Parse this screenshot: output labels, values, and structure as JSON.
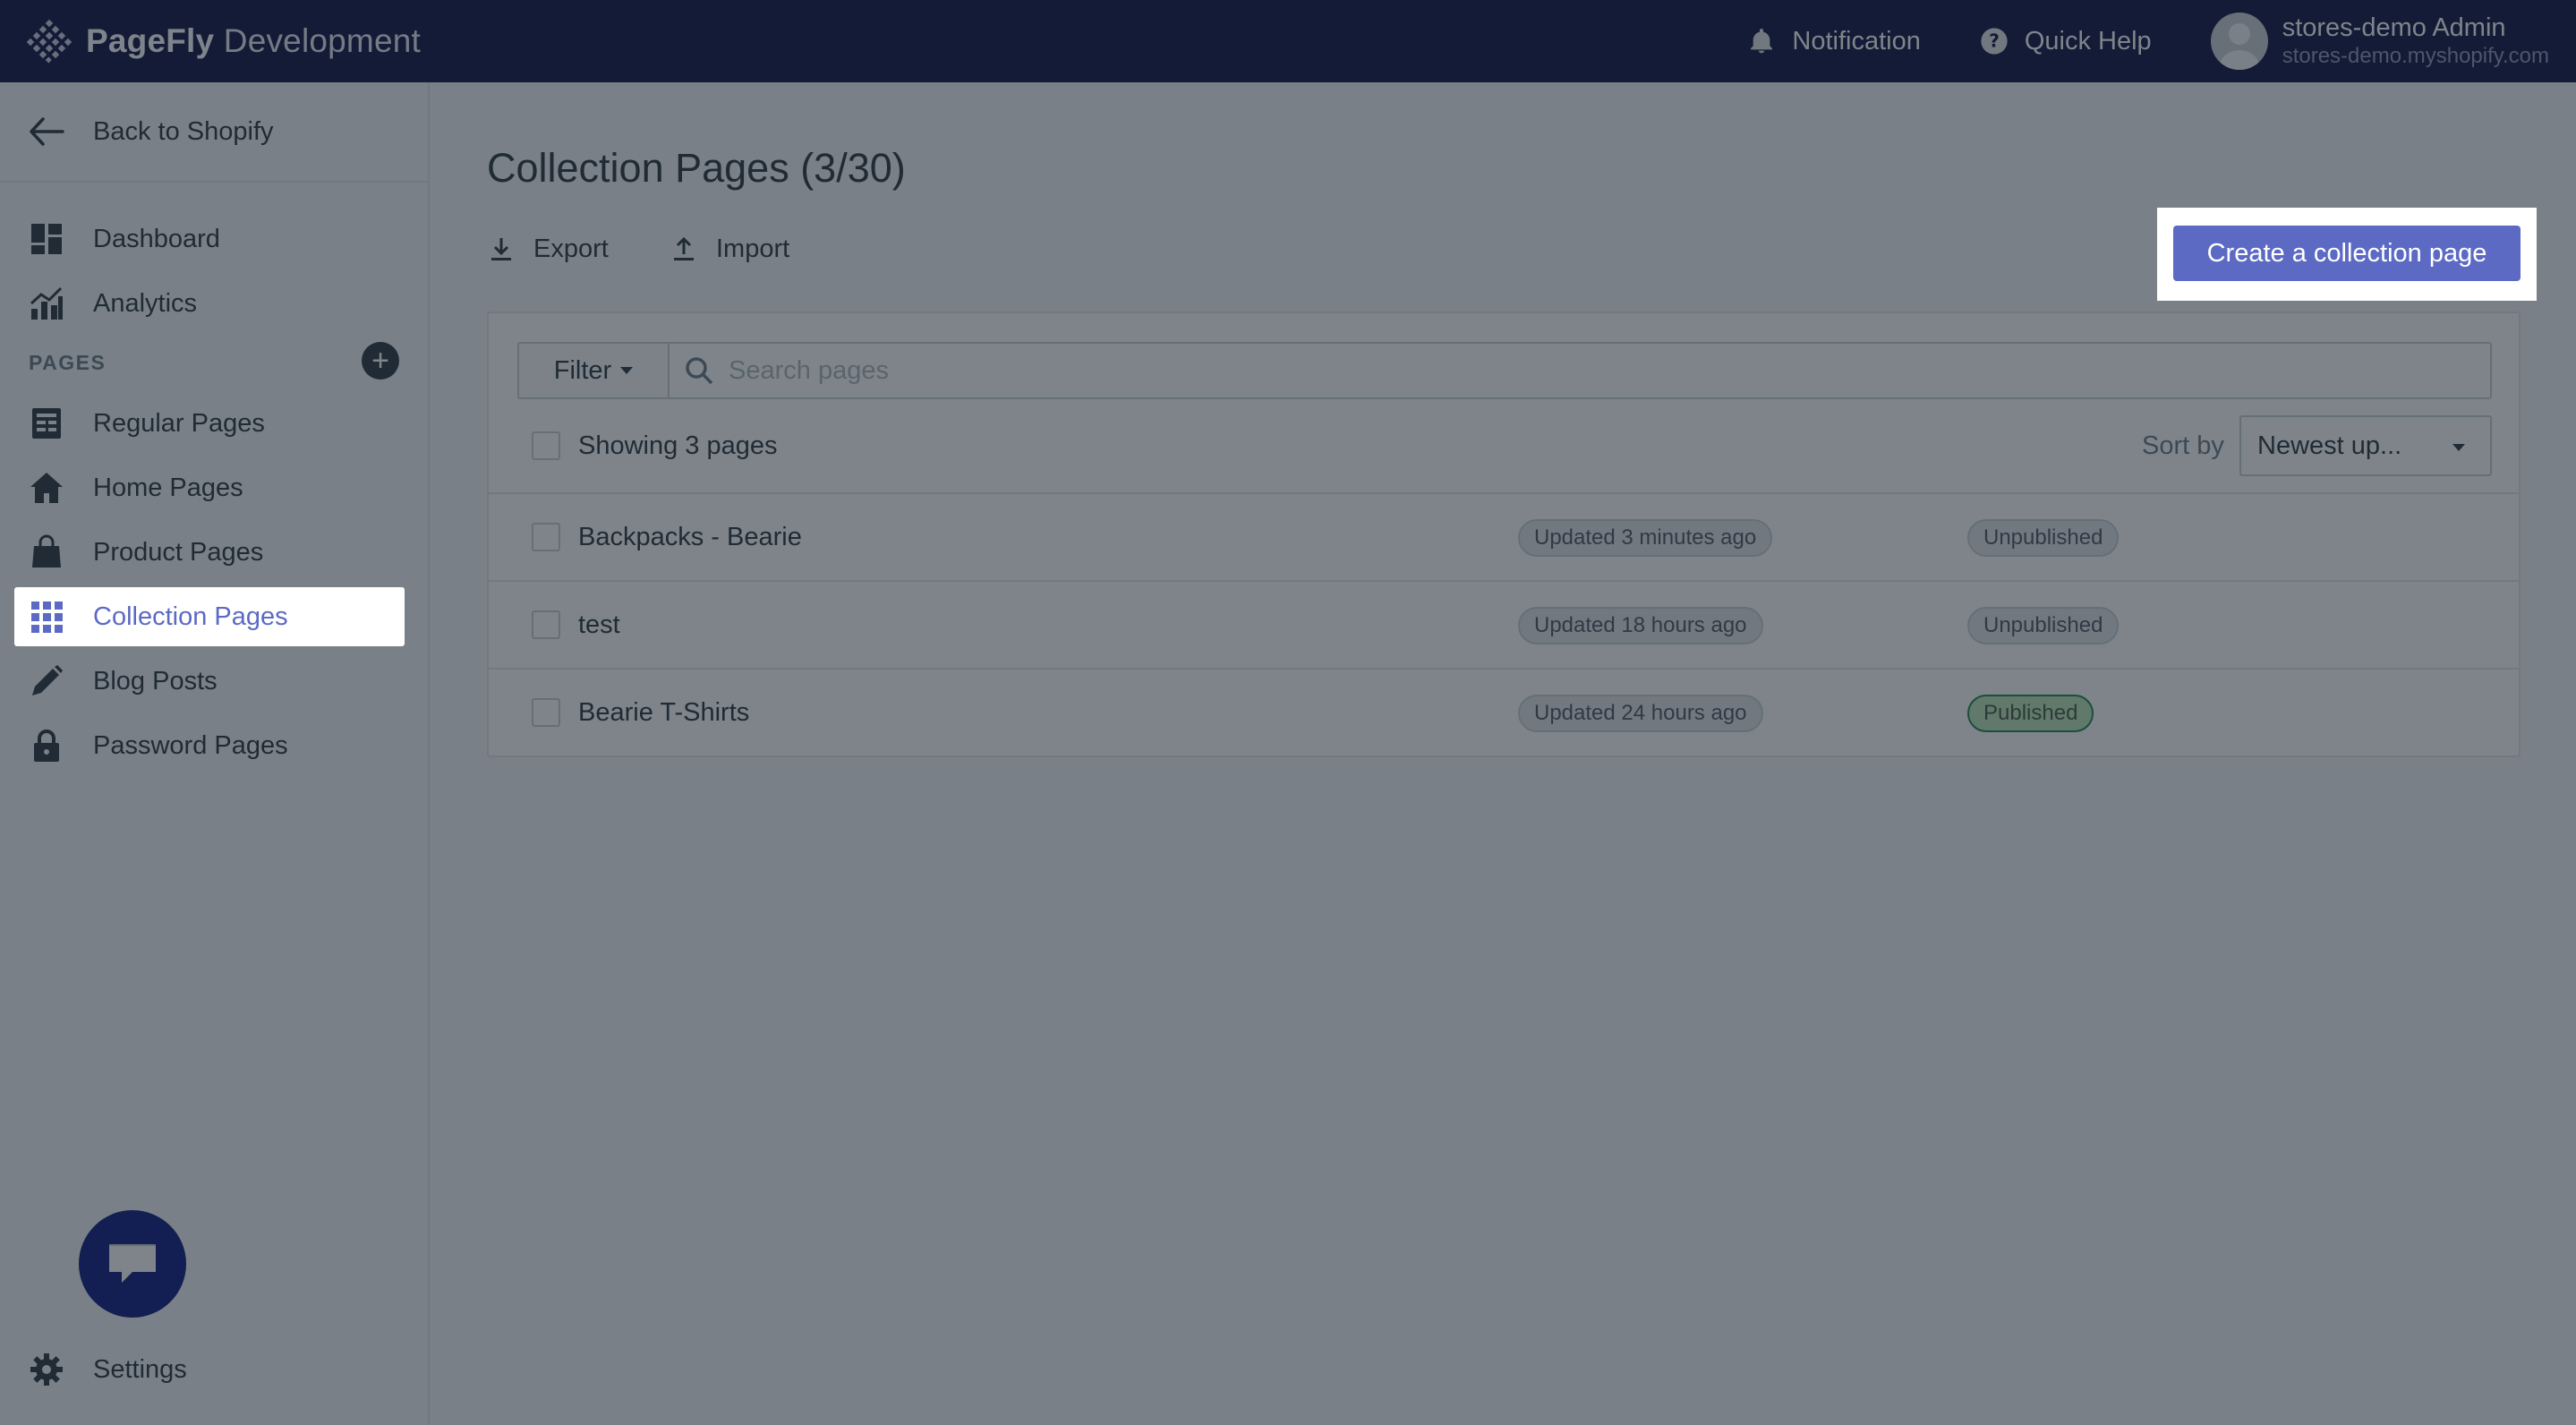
{
  "header": {
    "brand_bold": "PageFly",
    "brand_rest": " Development",
    "notification_label": "Notification",
    "quick_help_label": "Quick Help",
    "user_name": "stores-demo Admin",
    "user_store": "stores-demo.myshopify.com"
  },
  "sidebar": {
    "back_label": "Back to Shopify",
    "items": [
      {
        "label": "Dashboard",
        "icon": "dashboard-icon"
      },
      {
        "label": "Analytics",
        "icon": "analytics-icon"
      }
    ],
    "section_label": "PAGES",
    "pages": [
      {
        "label": "Regular Pages",
        "icon": "document-icon"
      },
      {
        "label": "Home Pages",
        "icon": "home-icon"
      },
      {
        "label": "Product Pages",
        "icon": "shopping-bag-icon"
      },
      {
        "label": "Collection Pages",
        "icon": "grid-icon",
        "active": true
      },
      {
        "label": "Blog Posts",
        "icon": "pencil-icon"
      },
      {
        "label": "Password Pages",
        "icon": "lock-icon"
      }
    ],
    "settings_label": "Settings"
  },
  "main": {
    "title": "Collection Pages (3/30)",
    "export_label": "Export",
    "import_label": "Import",
    "create_label": "Create a collection page",
    "filter_label": "Filter",
    "search_placeholder": "Search pages",
    "showing_label": "Showing 3 pages",
    "sort_label": "Sort by",
    "sort_value": "Newest up...",
    "rows": [
      {
        "name": "Backpacks - Bearie",
        "updated": "Updated 3 minutes ago",
        "status": "Unpublished"
      },
      {
        "name": "test",
        "updated": "Updated 18 hours ago",
        "status": "Unpublished"
      },
      {
        "name": "Bearie T-Shirts",
        "updated": "Updated 24 hours ago",
        "status": "Published"
      }
    ]
  },
  "colors": {
    "topbar": "#000639",
    "accent": "#5c6ac4",
    "published_bg": "#bbe5b3"
  }
}
